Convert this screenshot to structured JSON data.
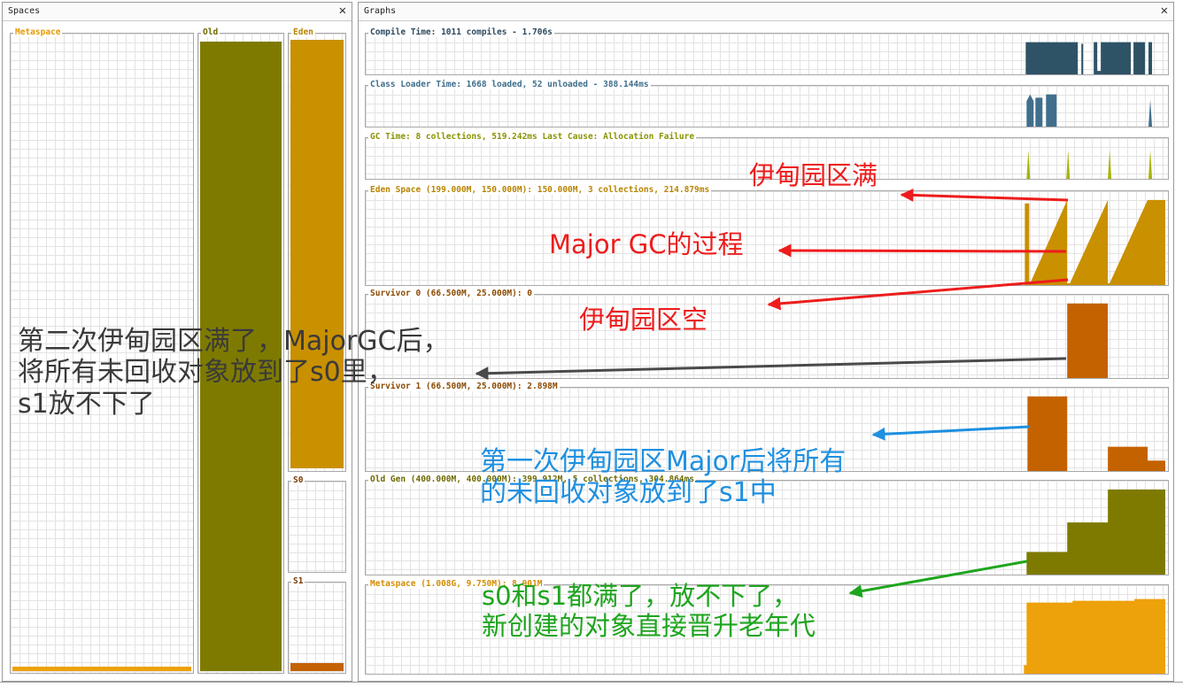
{
  "spaces_panel": {
    "title": "Spaces",
    "close": "✕",
    "metaspace": {
      "label": "Metaspace",
      "fill_fraction": 0.01
    },
    "old": {
      "label": "Old",
      "fill_fraction": 1.0
    },
    "eden": {
      "label": "Eden",
      "fill_fraction": 1.0
    },
    "s0": {
      "label": "S0",
      "fill_fraction": 0.0
    },
    "s1": {
      "label": "S1",
      "fill_fraction": 0.1
    }
  },
  "graphs_panel": {
    "title": "Graphs",
    "close": "✕",
    "compile": {
      "label": "Compile Time: 1011 compiles - 1.706s"
    },
    "classloader": {
      "label": "Class Loader Time: 1668 loaded, 52 unloaded - 388.144ms"
    },
    "gc": {
      "label": "GC Time: 8 collections, 519.242ms Last Cause: Allocation Failure"
    },
    "eden": {
      "label": "Eden Space (199.000M, 150.000M): 150.000M, 3 collections, 214.879ms"
    },
    "survivor0": {
      "label": "Survivor 0 (66.500M, 25.000M): 0"
    },
    "survivor1": {
      "label": "Survivor 1 (66.500M, 25.000M): 2.898M"
    },
    "oldgen": {
      "label": "Old Gen (400.000M, 400.000M): 399.912M, 5 collections, 304.864ms"
    },
    "metaspace": {
      "label": "Metaspace (1.008G, 9.750M): 8.901M"
    }
  },
  "annotations": {
    "eden_full": "伊甸园区满",
    "major_gc": "Major GC的过程",
    "eden_empty": "伊甸园区空",
    "second_full_line1": "第二次伊甸园区满了，MajorGC后，",
    "second_full_line2": "将所有未回收对象放到了s0里，",
    "second_full_line3": "s1放不下了",
    "first_major_line1": "第一次伊甸园区Major后将所有",
    "first_major_line2": "的未回收对象放到了s1中",
    "promote_line1": "s0和s1都满了，放不下了，",
    "promote_line2": "新创建的对象直接晋升老年代"
  },
  "colors": {
    "compile": "#2e5266",
    "classloader": "#3f6f8c",
    "gc": "#a8b400",
    "eden": "#c99000",
    "survivor": "#c46200",
    "old": "#7e7a00",
    "metaspace": "#eda10b",
    "red_note": "#ee1c1c",
    "blue_note": "#1e90e0",
    "green_note": "#1ea51e",
    "gray_note": "#4a4a4a"
  }
}
